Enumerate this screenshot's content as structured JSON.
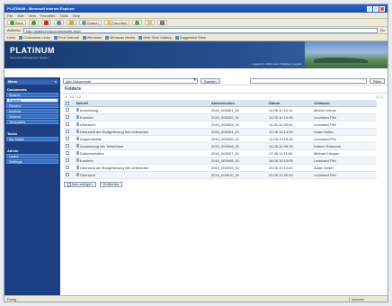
{
  "window": {
    "title": "PLATINUM - Microsoft Internet Explorer"
  },
  "menu": [
    "File",
    "Edit",
    "View",
    "Favorites",
    "Tools",
    "Help"
  ],
  "toolbar": {
    "back_label": "Back",
    "forward_label": "",
    "search_label": "Search",
    "favorites_label": "Favorites",
    "media_label": ""
  },
  "address": {
    "label": "Address",
    "value": "http://platinum/documents/list.aspx",
    "go_label": "Go"
  },
  "links": [
    "Links",
    "Customize Links",
    "Free Hotmail",
    "Windows",
    "Windows Media",
    "Web Slice Gallery",
    "Suggested Sites"
  ],
  "app": {
    "brand": "PLATINUM",
    "subtitle": "Document Management System",
    "user_info": "Logged in: Admin user | Settings | Logout"
  },
  "sidebar": {
    "header": "Menu",
    "header_right": "«",
    "sections": [
      {
        "title": "Documents",
        "items": [
          "Search",
          "Folders",
          "Recent",
          "Archive",
          "Shared",
          "Templates"
        ]
      },
      {
        "title": "Tasks",
        "items": [
          "My Tasks"
        ]
      },
      {
        "title": "Admin",
        "items": [
          "Users",
          "Settings"
        ]
      }
    ]
  },
  "search": {
    "scope_value": "Alle Dokumente",
    "go_label": "Suchen",
    "filter_label": "Filter"
  },
  "page": {
    "title": "Folders",
    "crumb": "1 - 12 / 12",
    "crumb_right": "1 / 1"
  },
  "table": {
    "columns": [
      "",
      "Betreff",
      "Aktenzeichen",
      "Datum",
      "Verfasser"
    ],
    "rows": [
      [
        "Anmeldung",
        "2010_000001_01",
        "10.05.10 10:11",
        "Michel Lehner"
      ],
      [
        "Kurzinfo",
        "2010_000002_01",
        "10.05.10 10:45",
        "Leonhard Piel"
      ],
      [
        "Übersicht",
        "2010_000003_01",
        "11.05.10 09:20",
        "Leonhard Piel"
      ],
      [
        "Übersicht der Budgetierung mit Lieferanten",
        "2010_000004_01",
        "12.05.10 14:00",
        "Adam Keller"
      ],
      [
        "Angebotsliste",
        "2010_000005_01",
        "12.05.10 15:30",
        "Leonhard Piel"
      ],
      [
        "Auswertung der Teilnehmer",
        "2010_000006_01",
        "14.05.10 08:15",
        "Kathrin Rotmann"
      ],
      [
        "Dokumentation",
        "2010_000007_01",
        "17.05.10 11:00",
        "Michael Hünger"
      ],
      [
        "Kurzinfo",
        "2010_000008_01",
        "18.05.10 10:05",
        "Leonhard Piel"
      ],
      [
        "Übersicht der Budgetierung mit Lieferanten",
        "2010_000009_01",
        "19.05.10 13:40",
        "Adam Keller"
      ],
      [
        "Übersicht",
        "2010_000010_01",
        "20.05.10 09:00",
        "Leonhard Piel"
      ]
    ]
  },
  "actions": {
    "new_label": "Neu anlegen",
    "delete_label": "Entfernen"
  },
  "status": {
    "text": "Fertig",
    "zone": "Internet"
  }
}
